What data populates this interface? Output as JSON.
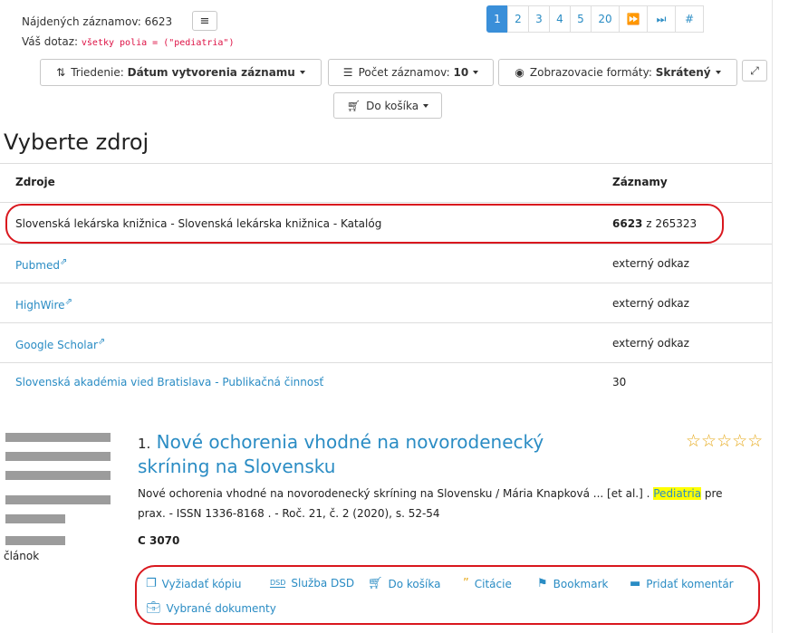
{
  "header": {
    "found_label": "Nájdených záznamov: 6623",
    "query_label": "Váš dotaz:",
    "query_value": "všetky polia = (\"pediatria\")",
    "pager": [
      "1",
      "2",
      "3",
      "4",
      "5",
      "20",
      "⏩",
      "⏭",
      "#"
    ]
  },
  "toolbar": {
    "sort_prefix": "Triedenie:",
    "sort_value": "Dátum vytvorenia záznamu",
    "count_prefix": "Počet záznamov:",
    "count_value": "10",
    "format_prefix": "Zobrazovacie formáty:",
    "format_value": "Skrátený",
    "cart_label": "Do košíka"
  },
  "sources": {
    "heading": "Vyberte zdroj",
    "col_sources": "Zdroje",
    "col_records": "Záznamy",
    "rows": [
      {
        "name": "Slovenská lekárska knižnica - Slovenská lekárska knižnica - Katalóg",
        "count_bold": "6623",
        "count_rest": " z 265323"
      },
      {
        "name": "Pubmed",
        "count_bold": "",
        "count_rest": "externý odkaz"
      },
      {
        "name": "HighWire",
        "count_bold": "",
        "count_rest": "externý odkaz"
      },
      {
        "name": "Google Scholar",
        "count_bold": "",
        "count_rest": "externý odkaz"
      },
      {
        "name": "Slovenská akadémia vied Bratislava - Publikačná činnosť",
        "count_bold": "",
        "count_rest": "30"
      }
    ]
  },
  "result": {
    "number": "1.",
    "title_line1": "Nové ochorenia vhodné na novorodenecký",
    "title_line2": "skríning na Slovensku",
    "stars": "☆☆☆☆☆",
    "desc_line1": "Nové ochorenia vhodné na novorodenecký skríning na Slovensku  / Mária Knapková ... [et al.] .",
    "desc_highlight": "Pediatria",
    "desc_after": " pre",
    "desc_line2": "prax. - ISSN 1336-8168 . - Roč. 21, č. 2 (2020), s. 52-54",
    "signature": "C 3070",
    "doc_type": "článok"
  },
  "actions": [
    {
      "label": "Vyžiadať kópiu",
      "icon": "copy-icon"
    },
    {
      "label": "Služba DSD",
      "icon": "dsd-icon"
    },
    {
      "label": "Do košíka",
      "icon": "cart-icon"
    },
    {
      "label": "Citácie",
      "icon": "quote-icon"
    },
    {
      "label": "Bookmark",
      "icon": "bookmark-icon"
    },
    {
      "label": "Pridať komentár",
      "icon": "comment-icon"
    },
    {
      "label": "Vybrané dokumenty",
      "icon": "briefcase-icon"
    }
  ],
  "colors": {
    "link": "#2a8cc4",
    "annotation": "#d9171e",
    "highlight": "#ffff00"
  }
}
